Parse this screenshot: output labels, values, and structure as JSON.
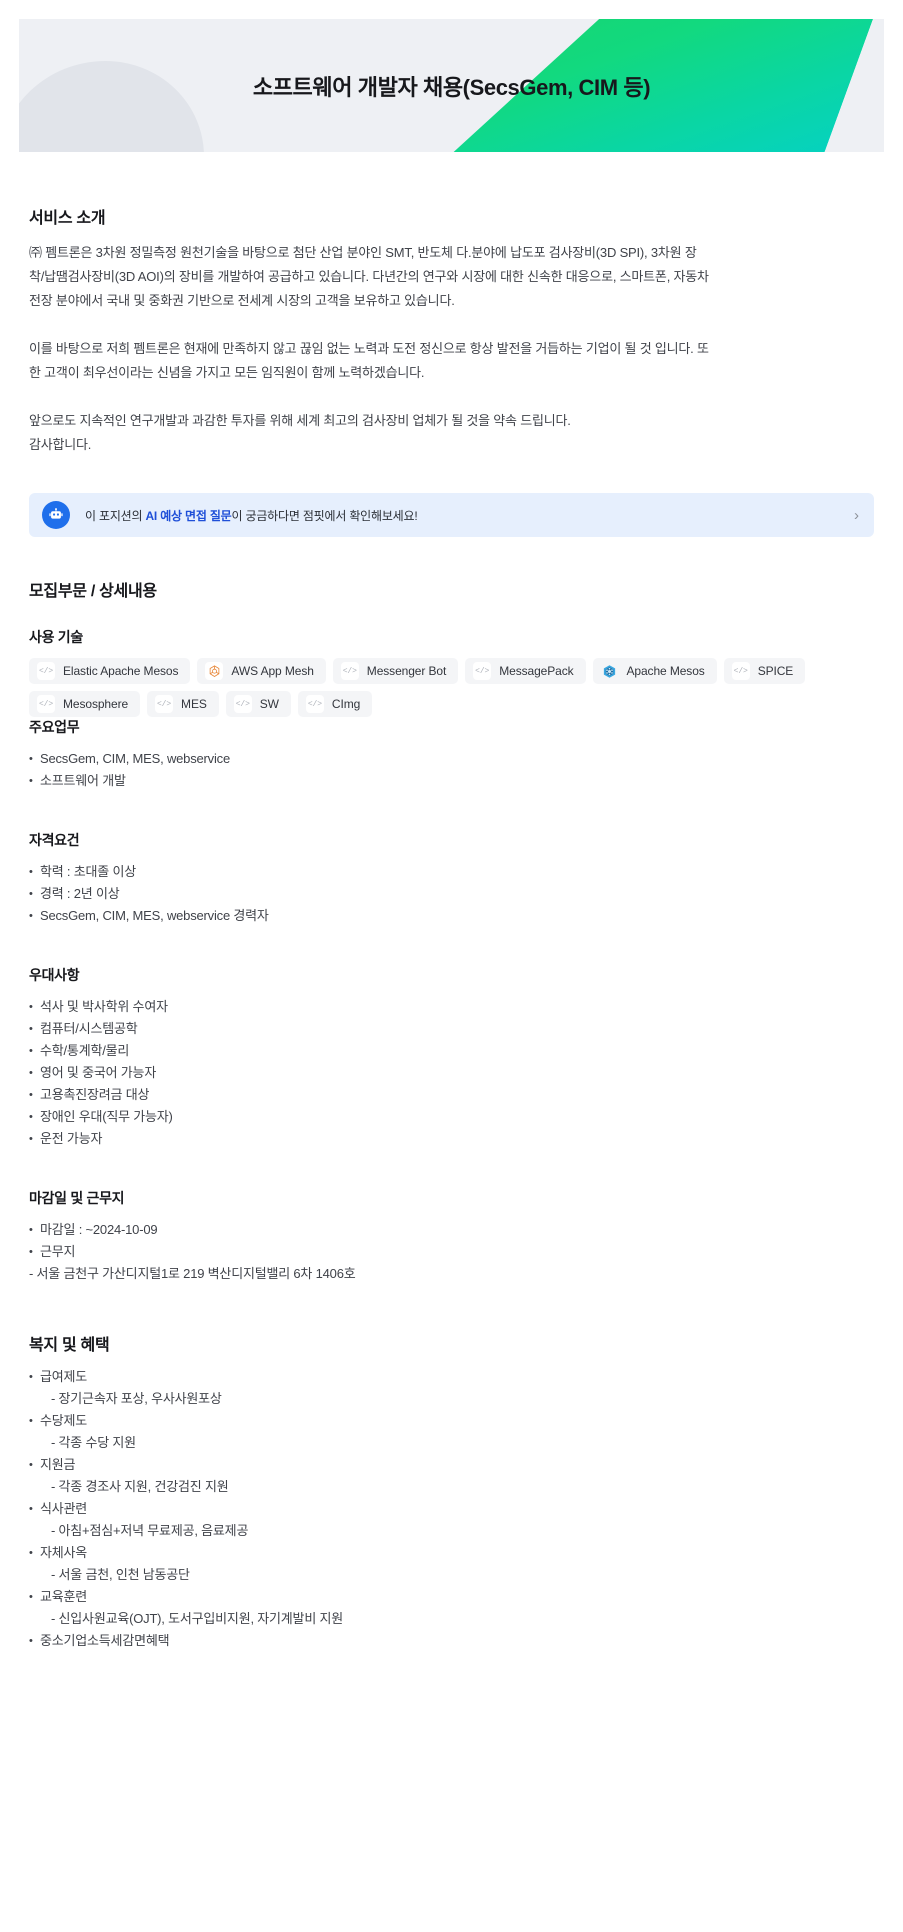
{
  "hero": {
    "title": "소프트웨어 개발자 채용(SecsGem, CIM 등)"
  },
  "intro": {
    "heading": "서비스 소개",
    "paragraphs": [
      "㈜ 펨트론은 3차원 정밀측정 원천기술을 바탕으로 첨단 산업 분야인 SMT, 반도체 다.분야에 납도포 검사장비(3D SPI), 3차원 장착/납땜검사장비(3D AOI)의 장비를 개발하여 공급하고 있습니다. 다년간의 연구와 시장에 대한 신속한 대응으로, 스마트폰, 자동차 전장 분야에서 국내 및 중화권 기반으로 전세계 시장의 고객을 보유하고 있습니다.",
      "이를 바탕으로 저희 펨트론은 현재에 만족하지 않고 끊임 없는 노력과 도전 정신으로 항상 발전을 거듭하는 기업이 될 것 입니다. 또한 고객이 최우선이라는 신념을 가지고 모든 임직원이 함께 노력하겠습니다.",
      "앞으로도 지속적인 연구개발과 과감한 투자를 위해 세계 최고의 검사장비 업체가 될 것을 약속 드립니다.\n감사합니다."
    ]
  },
  "ai_banner": {
    "icon": "robot-icon",
    "text_before": "이 포지션의 ",
    "text_highlight": "AI 예상 면접 질문",
    "text_after": "이 궁금하다면 점핏에서 확인해보세요!",
    "chevron": "›",
    "icon_color": "#1f6feb",
    "background_color": "#e6effd"
  },
  "recruit": {
    "heading": "모집부문 / 상세내용",
    "tech": {
      "heading": "사용 기술",
      "tags": [
        {
          "label": "Elastic Apache Mesos",
          "icon": "code-icon",
          "icon_glyph": "</>"
        },
        {
          "label": "AWS App Mesh",
          "icon": "aws-app-mesh-icon",
          "icon_glyph": ""
        },
        {
          "label": "Messenger Bot",
          "icon": "code-icon",
          "icon_glyph": "</>"
        },
        {
          "label": "MessagePack",
          "icon": "code-icon",
          "icon_glyph": "</>"
        },
        {
          "label": "Apache Mesos",
          "icon": "apache-mesos-icon",
          "icon_glyph": ""
        },
        {
          "label": "SPICE",
          "icon": "code-icon",
          "icon_glyph": "</>"
        },
        {
          "label": "Mesosphere",
          "icon": "code-icon",
          "icon_glyph": "</>"
        },
        {
          "label": "MES",
          "icon": "code-icon",
          "icon_glyph": "</>"
        },
        {
          "label": "SW",
          "icon": "code-icon",
          "icon_glyph": "</>"
        },
        {
          "label": "CImg",
          "icon": "code-icon",
          "icon_glyph": "</>"
        }
      ]
    },
    "sections": [
      {
        "heading": "주요업무",
        "items": [
          {
            "text": "SecsGem, CIM, MES, webservice",
            "style": "bullet"
          },
          {
            "text": "소프트웨어 개발",
            "style": "bullet"
          }
        ]
      },
      {
        "heading": "자격요건",
        "items": [
          {
            "text": "학력 : 초대졸 이상",
            "style": "bullet"
          },
          {
            "text": "경력 : 2년 이상",
            "style": "bullet"
          },
          {
            "text": "SecsGem, CIM, MES, webservice 경력자",
            "style": "bullet"
          }
        ]
      },
      {
        "heading": "우대사항",
        "items": [
          {
            "text": "석사 및 박사학위 수여자",
            "style": "bullet"
          },
          {
            "text": "컴퓨터/시스템공학",
            "style": "bullet"
          },
          {
            "text": "수학/통계학/물리",
            "style": "bullet"
          },
          {
            "text": "영어 및 중국어 가능자",
            "style": "bullet"
          },
          {
            "text": "고용촉진장려금 대상",
            "style": "bullet"
          },
          {
            "text": "장애인 우대(직무 가능자)",
            "style": "bullet"
          },
          {
            "text": "운전 가능자",
            "style": "bullet"
          }
        ]
      },
      {
        "heading": "마감일 및 근무지",
        "items": [
          {
            "text": "마감일 : ~2024-10-09",
            "style": "bullet"
          },
          {
            "text": "근무지",
            "style": "bullet"
          },
          {
            "text": "- 서울 금천구 가산디지털1로 219 벽산디지털밸리 6차 1406호",
            "style": "dash"
          }
        ]
      }
    ]
  },
  "benefits": {
    "heading": "복지 및 혜택",
    "items": [
      {
        "text": "급여제도",
        "style": "bullet"
      },
      {
        "text": "- 장기근속자 포상, 우사사원포상",
        "style": "indent"
      },
      {
        "text": "수당제도",
        "style": "bullet"
      },
      {
        "text": "- 각종 수당 지원",
        "style": "indent"
      },
      {
        "text": "지원금",
        "style": "bullet"
      },
      {
        "text": "- 각종 경조사 지원, 건강검진 지원",
        "style": "indent"
      },
      {
        "text": "식사관련",
        "style": "bullet"
      },
      {
        "text": "- 아침+점심+저녁 무료제공, 음료제공",
        "style": "indent"
      },
      {
        "text": "자체사옥",
        "style": "bullet"
      },
      {
        "text": "- 서울 금천, 인천 남동공단",
        "style": "indent"
      },
      {
        "text": "교육훈련",
        "style": "bullet"
      },
      {
        "text": "- 신입사원교육(OJT), 도서구입비지원, 자기계발비 지원",
        "style": "indent"
      },
      {
        "text": "중소기업소득세감면혜택",
        "style": "bullet"
      }
    ]
  }
}
